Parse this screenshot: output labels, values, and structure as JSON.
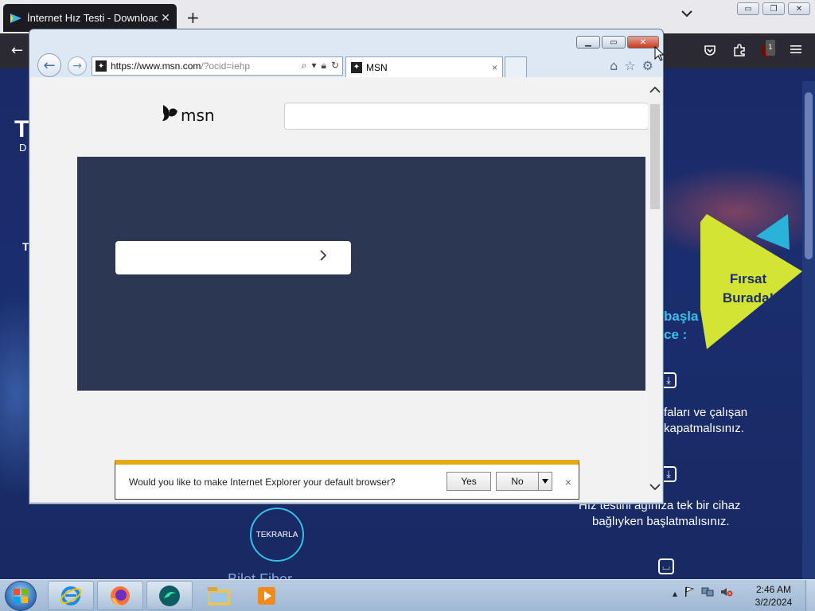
{
  "firefox": {
    "tab_title": "İnternet Hız Testi - Download &",
    "tab_close": "✕",
    "new_tab": "+",
    "list_tabs": "⌄",
    "window_buttons": [
      "▭",
      "❐",
      "✕"
    ],
    "nav_back": "←",
    "toolbar_icons": [
      "pocket-icon",
      "extensions-icon",
      "ublock-icon",
      "menu-icon"
    ],
    "ublock_badge": "1"
  },
  "page": {
    "heading_fragment": "T",
    "sub_fragment": "D",
    "side_fragment": "T",
    "cyan_line1": "başla",
    "cyan_line2": "ce :",
    "text1_line1": "faları ve çalışan",
    "text1_line2": "kapatmalısınız.",
    "text2_line1": "Hız testini ağınıza tek bir cihaz",
    "text2_line2": "bağlıyken başlatmalısınız.",
    "promo_line1": "Fırsat",
    "promo_line2": "Burada!",
    "tekrarla": "TEKRARLA",
    "bottom_partial": "Bilet Fiber",
    "colors": {
      "bg": "#1a2a68",
      "accent_cyan": "#3ac0e8",
      "promo_yellow": "#d4e432"
    }
  },
  "ie": {
    "url_main": "https://www.msn.com",
    "url_rest": "/?ocid=iehp",
    "tab_label": "MSN",
    "tab_close": "×",
    "msn_logo_text": "msn",
    "notification": {
      "text": "Would you like to make Internet Explorer your default browser?",
      "yes": "Yes",
      "no": "No",
      "close": "×"
    },
    "colors": {
      "hero": "#2b3753",
      "notif_bar": "#e4aa15"
    }
  },
  "taskbar": {
    "time": "2:46 AM",
    "date": "3/2/2024",
    "apps": [
      "internet-explorer-icon",
      "firefox-icon",
      "app-icon",
      "file-explorer-icon",
      "media-player-icon"
    ]
  }
}
